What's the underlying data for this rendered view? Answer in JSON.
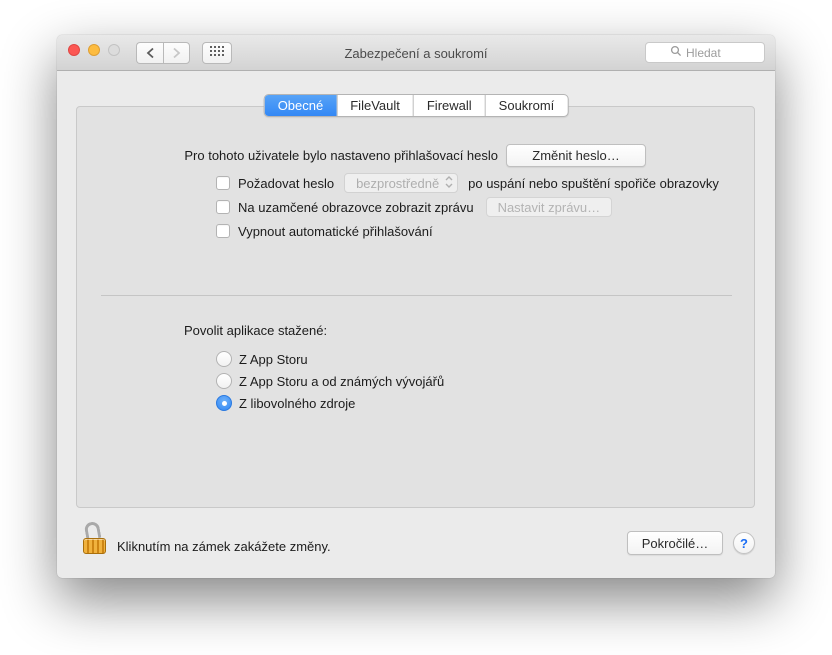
{
  "window": {
    "title": "Zabezpečení a soukromí",
    "search": {
      "placeholder": "Hledat"
    }
  },
  "tabs": [
    {
      "label": "Obecné",
      "selected": true
    },
    {
      "label": "FileVault",
      "selected": false
    },
    {
      "label": "Firewall",
      "selected": false
    },
    {
      "label": "Soukromí",
      "selected": false
    }
  ],
  "general": {
    "password_status": "Pro tohoto uživatele bylo nastaveno přihlašovací heslo",
    "change_password_button": "Změnit heslo…",
    "require_password": {
      "checked": false,
      "label_before": "Požadovat heslo",
      "popup_value": "bezprostředně",
      "label_after": "po uspání nebo spuštění spořiče obrazovky"
    },
    "lock_message": {
      "checked": false,
      "label": "Na uzamčené obrazovce zobrazit zprávu",
      "button": "Nastavit zprávu…"
    },
    "auto_login": {
      "checked": false,
      "label": "Vypnout automatické přihlašování"
    },
    "allow_apps_label": "Povolit aplikace stažené:",
    "app_sources": [
      {
        "label": "Z App Storu",
        "selected": false
      },
      {
        "label": "Z App Storu a od známých vývojářů",
        "selected": false
      },
      {
        "label": "Z libovolného zdroje",
        "selected": true
      }
    ]
  },
  "footer": {
    "lock_text": "Kliknutím na zámek zakážete změny.",
    "advanced_button": "Pokročilé…",
    "help_label": "?"
  },
  "colors": {
    "accent_blue": "#3388f5",
    "lock_gold": "#e8a32a",
    "panel_gray": "#e2e2e2",
    "window_gray": "#ebebeb"
  }
}
